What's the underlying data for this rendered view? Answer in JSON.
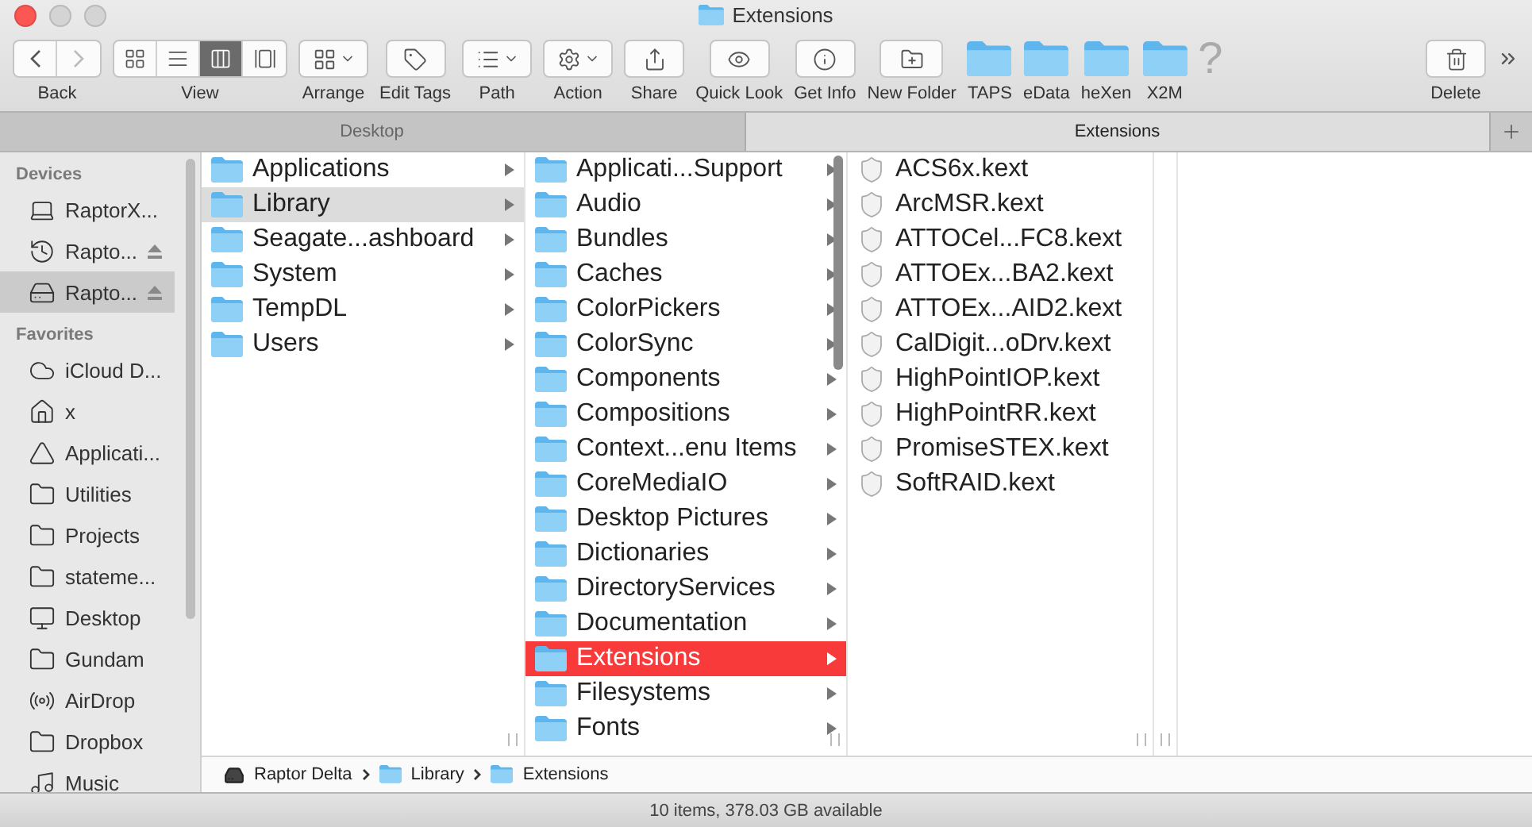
{
  "window": {
    "title": "Extensions"
  },
  "toolbar": [
    {
      "kind": "nav",
      "label": "Back"
    },
    {
      "kind": "view",
      "label": "View",
      "segments": [
        {
          "selected": false
        },
        {
          "selected": false
        },
        {
          "selected": true
        },
        {
          "selected": false
        }
      ]
    },
    {
      "kind": "menu",
      "label": "Arrange"
    },
    {
      "kind": "button",
      "label": "Edit Tags"
    },
    {
      "kind": "menu",
      "label": "Path"
    },
    {
      "kind": "menu",
      "label": "Action"
    },
    {
      "kind": "button",
      "label": "Share"
    },
    {
      "kind": "button",
      "label": "Quick Look"
    },
    {
      "kind": "button",
      "label": "Get Info"
    },
    {
      "kind": "button",
      "label": "New Folder"
    },
    {
      "kind": "shortcut",
      "label": "TAPS"
    },
    {
      "kind": "shortcut",
      "label": "eData"
    },
    {
      "kind": "shortcut",
      "label": "heXen"
    },
    {
      "kind": "shortcut",
      "label": "X2M"
    },
    {
      "kind": "help",
      "label": "?"
    }
  ],
  "toolbar_right": {
    "label": "Delete"
  },
  "tabs": [
    {
      "label": "Desktop",
      "selected": false
    },
    {
      "label": "Extensions",
      "selected": true
    }
  ],
  "sidebar": {
    "sections": [
      {
        "title": "Devices",
        "items": [
          {
            "kind": "laptop",
            "label": "RaptorX...",
            "eject": false,
            "selected": false
          },
          {
            "kind": "backup-disk",
            "label": "Rapto...",
            "eject": true,
            "selected": false
          },
          {
            "kind": "disk",
            "label": "Rapto...",
            "eject": true,
            "selected": true
          }
        ]
      },
      {
        "title": "Favorites",
        "items": [
          {
            "kind": "cloud",
            "label": "iCloud D...",
            "eject": false,
            "selected": false
          },
          {
            "kind": "home",
            "label": "x",
            "eject": false,
            "selected": false
          },
          {
            "kind": "apps",
            "label": "Applicati...",
            "eject": false,
            "selected": false
          },
          {
            "kind": "folder",
            "label": "Utilities",
            "eject": false,
            "selected": false
          },
          {
            "kind": "folder",
            "label": "Projects",
            "eject": false,
            "selected": false
          },
          {
            "kind": "folder",
            "label": "stateme...",
            "eject": false,
            "selected": false
          },
          {
            "kind": "desktop",
            "label": "Desktop",
            "eject": false,
            "selected": false
          },
          {
            "kind": "folder",
            "label": "Gundam",
            "eject": false,
            "selected": false
          },
          {
            "kind": "airdrop",
            "label": "AirDrop",
            "eject": false,
            "selected": false
          },
          {
            "kind": "folder",
            "label": "Dropbox",
            "eject": false,
            "selected": false
          },
          {
            "kind": "music",
            "label": "Music",
            "eject": false,
            "selected": false
          }
        ]
      }
    ]
  },
  "columns": [
    {
      "focused": false,
      "items": [
        {
          "kind": "folder",
          "name": "Applications",
          "selected": false
        },
        {
          "kind": "folder",
          "name": "Library",
          "selected": true
        },
        {
          "kind": "folder",
          "name": "Seagate...ashboard",
          "selected": false
        },
        {
          "kind": "folder",
          "name": "System",
          "selected": false
        },
        {
          "kind": "folder",
          "name": "TempDL",
          "selected": false
        },
        {
          "kind": "folder",
          "name": "Users",
          "selected": false
        }
      ]
    },
    {
      "focused": true,
      "items": [
        {
          "kind": "folder",
          "name": "Applicati...Support",
          "selected": false
        },
        {
          "kind": "folder",
          "name": "Audio",
          "selected": false
        },
        {
          "kind": "folder",
          "name": "Bundles",
          "selected": false
        },
        {
          "kind": "folder",
          "name": "Caches",
          "selected": false
        },
        {
          "kind": "folder",
          "name": "ColorPickers",
          "selected": false
        },
        {
          "kind": "folder",
          "name": "ColorSync",
          "selected": false
        },
        {
          "kind": "folder",
          "name": "Components",
          "selected": false
        },
        {
          "kind": "folder",
          "name": "Compositions",
          "selected": false
        },
        {
          "kind": "folder",
          "name": "Context...enu Items",
          "selected": false
        },
        {
          "kind": "folder",
          "name": "CoreMediaIO",
          "selected": false
        },
        {
          "kind": "folder",
          "name": "Desktop Pictures",
          "selected": false
        },
        {
          "kind": "folder",
          "name": "Dictionaries",
          "selected": false
        },
        {
          "kind": "folder",
          "name": "DirectoryServices",
          "selected": false
        },
        {
          "kind": "folder",
          "name": "Documentation",
          "selected": false
        },
        {
          "kind": "folder",
          "name": "Extensions",
          "selected": true
        },
        {
          "kind": "folder",
          "name": "Filesystems",
          "selected": false
        },
        {
          "kind": "folder",
          "name": "Fonts",
          "selected": false
        }
      ]
    },
    {
      "items": [
        {
          "kind": "kext",
          "name": "ACS6x.kext",
          "selected": false
        },
        {
          "kind": "kext",
          "name": "ArcMSR.kext",
          "selected": false
        },
        {
          "kind": "kext",
          "name": "ATTOCel...FC8.kext",
          "selected": false
        },
        {
          "kind": "kext",
          "name": "ATTOEx...BA2.kext",
          "selected": false
        },
        {
          "kind": "kext",
          "name": "ATTOEx...AID2.kext",
          "selected": false
        },
        {
          "kind": "kext",
          "name": "CalDigit...oDrv.kext",
          "selected": false
        },
        {
          "kind": "kext",
          "name": "HighPointIOP.kext",
          "selected": false
        },
        {
          "kind": "kext",
          "name": "HighPointRR.kext",
          "selected": false
        },
        {
          "kind": "kext",
          "name": "PromiseSTEX.kext",
          "selected": false
        },
        {
          "kind": "kext",
          "name": "SoftRAID.kext",
          "selected": false
        }
      ]
    }
  ],
  "path_bar": [
    {
      "kind": "disk",
      "label": "Raptor Delta"
    },
    {
      "kind": "folder",
      "label": "Library"
    },
    {
      "kind": "folder",
      "label": "Extensions"
    }
  ],
  "status_bar": "10 items, 378.03 GB available"
}
